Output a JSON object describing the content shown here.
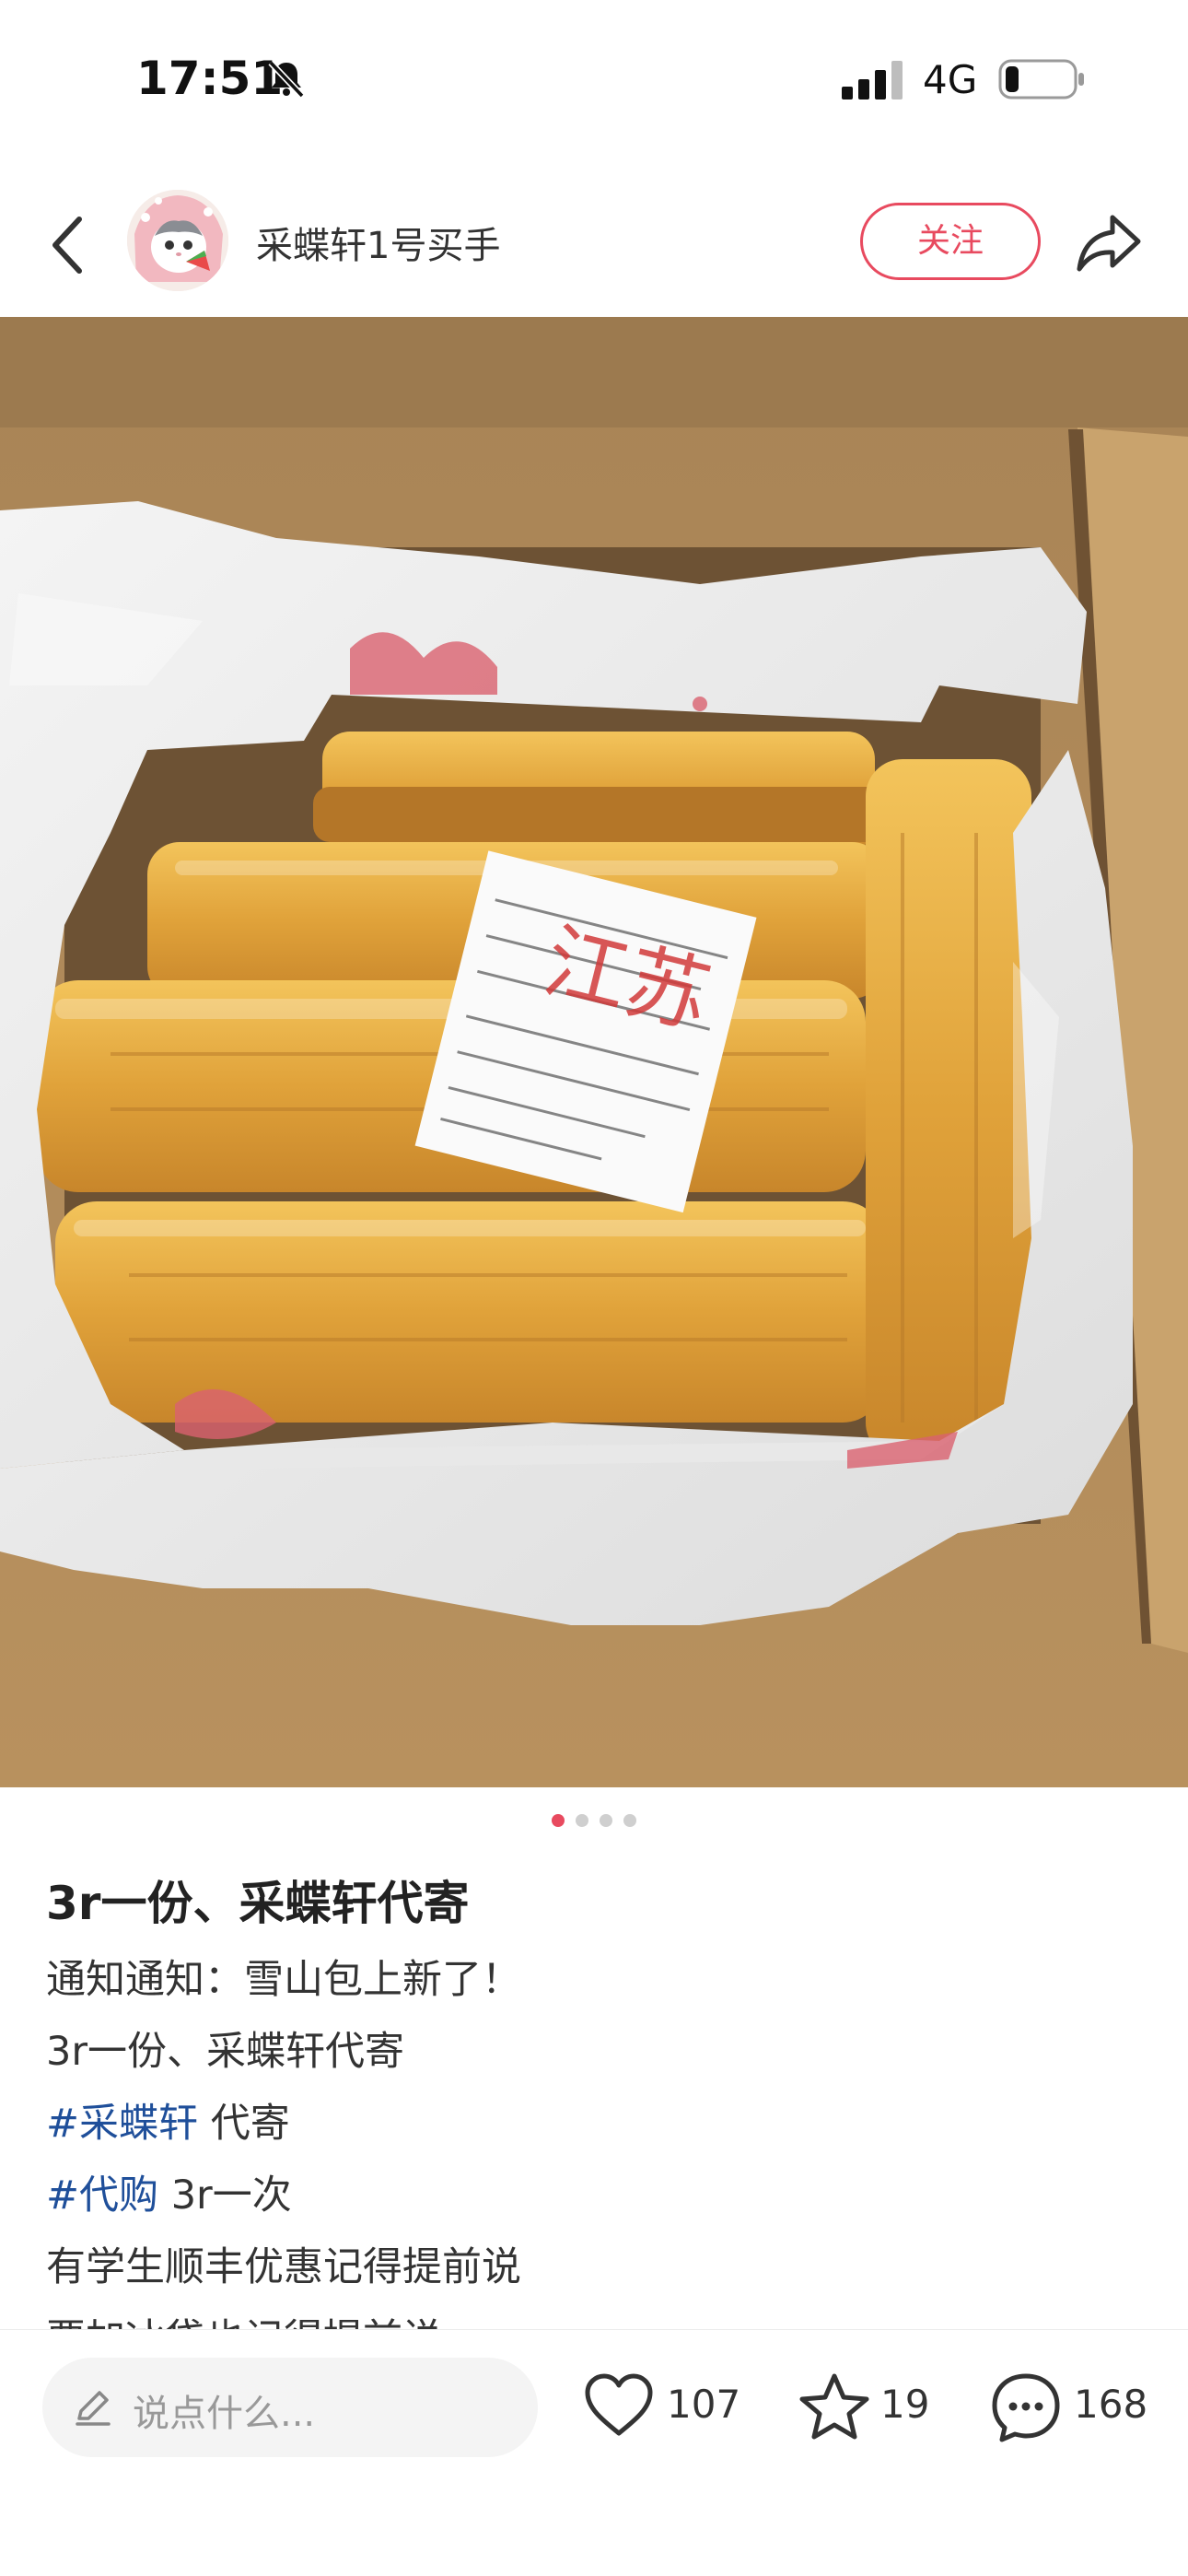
{
  "status_bar": {
    "time": "17:51",
    "network": "4G",
    "icons": [
      "bell-muted-icon",
      "signal-icon",
      "battery-icon"
    ]
  },
  "header": {
    "author_name": "采蝶轩1号买手",
    "follow_label": "关注",
    "icons": [
      "back-icon",
      "avatar",
      "share-icon"
    ]
  },
  "photo": {
    "receipt_handwriting": "江苏",
    "pager": {
      "total": 4,
      "active": 1
    }
  },
  "note": {
    "title": "3r一份、采蝶轩代寄",
    "lines": [
      {
        "text": "通知通知：雪山包上新了！"
      },
      {
        "text": "3r一份、采蝶轩代寄"
      },
      {
        "hashtag": "#采蝶轩",
        "text": " 代寄"
      },
      {
        "hashtag": "#代购",
        "text": " 3r一次"
      },
      {
        "text": "有学生顺丰优惠记得提前说"
      },
      {
        "text": "要加冰袋也记得提前说"
      }
    ]
  },
  "bottom_bar": {
    "comment_placeholder": "说点什么...",
    "like_count": "107",
    "collect_count": "19",
    "comment_count": "168"
  },
  "colors": {
    "accent": "#e84a5f",
    "hashtag": "#1f4f9a",
    "text": "#333333"
  }
}
